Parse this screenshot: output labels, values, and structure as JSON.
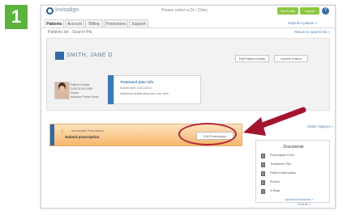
{
  "step_badge": "1",
  "app": {
    "logo_text": "Invisalign",
    "header_center": "Please select a Dr / Clinic",
    "header_buttons": [
      "My Profile",
      "Logout"
    ],
    "help_icon": "?"
  },
  "tabs": [
    "Patients",
    "Account",
    "Billing",
    "Promotions",
    "Support"
  ],
  "tabs_right_link": "Submit a patient »",
  "breadcrumb": "Patients list  ·  Search Pts",
  "breadcrumb_right": "Return to search list »",
  "patient": {
    "name": "SMITH, JANE D",
    "buttons": [
      "Edit Patient Details",
      "Archive Patient"
    ],
    "info_lines": [
      "Patient Details",
      "DOB 01/01/1985",
      "Doctor",
      "Address Phone Email"
    ],
    "card_title": "Treatment plan info",
    "card_lines": [
      "Submit date: 01/01/2012",
      "Additional details about the case here"
    ]
  },
  "prescription": {
    "icon": "!",
    "label_small": "Incomplete Prescription",
    "label": "Submit prescription",
    "button": "Edit Prescription",
    "right_link": "Order Aligners »"
  },
  "documents": {
    "title": "Documents",
    "items": [
      "Prescription Form",
      "Treatment Plan",
      "Patient Information",
      "Photos",
      "X-Rays"
    ],
    "footer_links": [
      "Upload Documents »",
      "Print All »"
    ]
  },
  "colors": {
    "badge": "#5db33e",
    "accent_green": "#8cc63f",
    "brand_blue": "#3c78b8",
    "highlight": "#b0243c"
  }
}
